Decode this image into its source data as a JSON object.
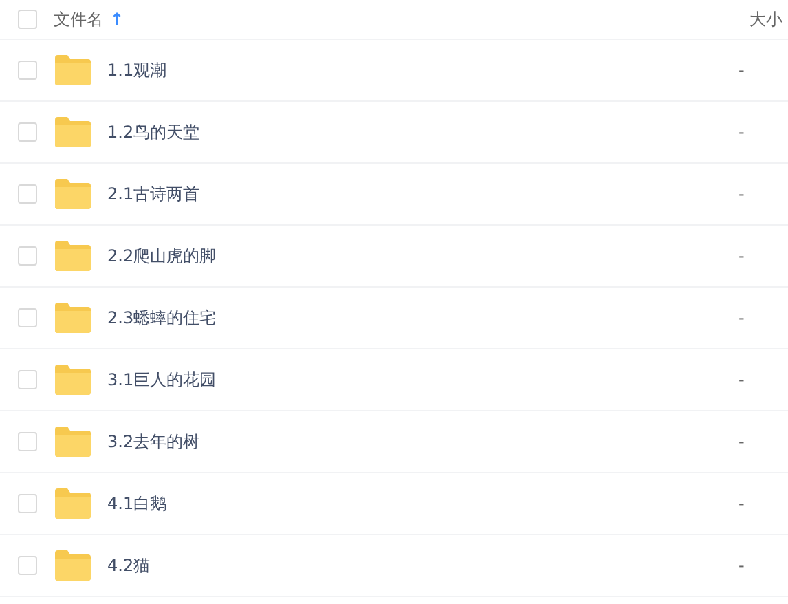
{
  "header": {
    "checked": false,
    "name_label": "文件名",
    "sort_arrow": "↑",
    "size_label": "大小"
  },
  "rows": [
    {
      "name": "1.1观潮",
      "size": "-",
      "checked": false
    },
    {
      "name": "1.2鸟的天堂",
      "size": "-",
      "checked": false
    },
    {
      "name": "2.1古诗两首",
      "size": "-",
      "checked": false
    },
    {
      "name": "2.2爬山虎的脚",
      "size": "-",
      "checked": false
    },
    {
      "name": "2.3蟋蟀的住宅",
      "size": "-",
      "checked": false
    },
    {
      "name": "3.1巨人的花园",
      "size": "-",
      "checked": false
    },
    {
      "name": "3.2去年的树",
      "size": "-",
      "checked": false
    },
    {
      "name": "4.1白鹅",
      "size": "-",
      "checked": false
    },
    {
      "name": "4.2猫",
      "size": "-",
      "checked": false
    }
  ]
}
